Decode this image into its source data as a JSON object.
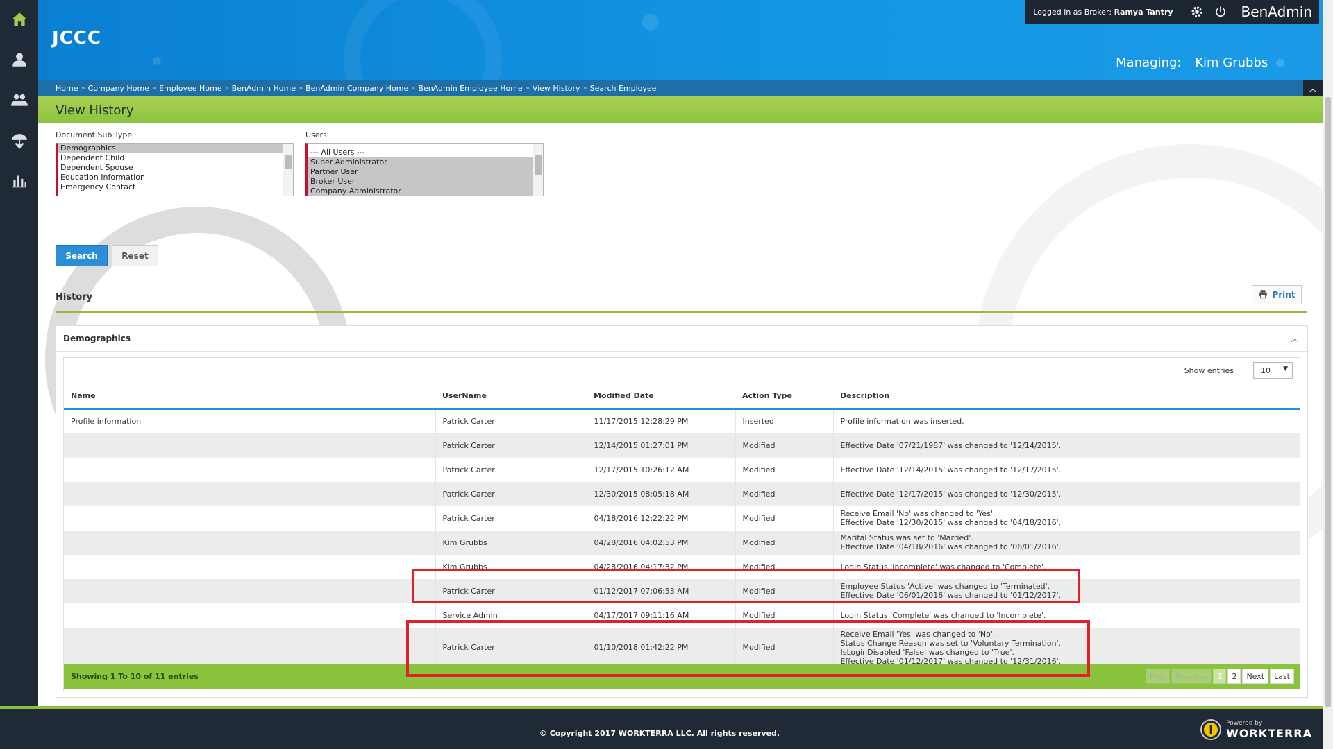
{
  "app": {
    "logo": "JCCC",
    "name": "BenAdmin"
  },
  "header": {
    "logged_in_label": "Logged in as Broker:",
    "user_name": "Ramya Tantry",
    "managing_label": "Managing:",
    "managing_name": "Kim Grubbs"
  },
  "sidebar": {
    "items": [
      {
        "icon": "home-icon"
      },
      {
        "icon": "person-icon"
      },
      {
        "icon": "people-icon"
      },
      {
        "icon": "benefits-icon"
      },
      {
        "icon": "bar-chart-icon"
      }
    ]
  },
  "breadcrumb": [
    "Home",
    "Company Home",
    "Employee Home",
    "BenAdmin Home",
    "BenAdmin Company Home",
    "BenAdmin Employee Home",
    "View History",
    "Search Employee"
  ],
  "page": {
    "title": "View History"
  },
  "filters": {
    "doc_subtype_label": "Document Sub Type",
    "doc_subtype_options": [
      "Demographics",
      "Dependent Child",
      "Dependent Spouse",
      "Education Information",
      "Emergency Contact"
    ],
    "doc_subtype_selected": "Demographics",
    "users_label": "Users",
    "users_options": [
      "--- All Users ---",
      "Super Administrator",
      "Partner User",
      "Broker User",
      "Company Administrator"
    ],
    "users_selected": [
      "Super Administrator",
      "Partner User",
      "Broker User",
      "Company Administrator"
    ]
  },
  "buttons": {
    "search": "Search",
    "reset": "Reset",
    "print": "Print"
  },
  "history": {
    "title": "History",
    "panel_title": "Demographics",
    "show_entries_label": "Show entries",
    "entries_value": "10",
    "columns": [
      "Name",
      "UserName",
      "Modified Date",
      "Action Type",
      "Description"
    ],
    "rows": [
      {
        "name": "Profile information",
        "user": "Patrick Carter",
        "date": "11/17/2015 12:28:29 PM",
        "action": "Inserted",
        "desc": [
          "Profile information was inserted."
        ]
      },
      {
        "name": "",
        "user": "Patrick Carter",
        "date": "12/14/2015 01:27:01 PM",
        "action": "Modified",
        "desc": [
          "Effective Date '07/21/1987' was changed to '12/14/2015'."
        ]
      },
      {
        "name": "",
        "user": "Patrick Carter",
        "date": "12/17/2015 10:26:12 AM",
        "action": "Modified",
        "desc": [
          "Effective Date '12/14/2015' was changed to '12/17/2015'."
        ]
      },
      {
        "name": "",
        "user": "Patrick Carter",
        "date": "12/30/2015 08:05:18 AM",
        "action": "Modified",
        "desc": [
          "Effective Date '12/17/2015' was changed to '12/30/2015'."
        ]
      },
      {
        "name": "",
        "user": "Patrick Carter",
        "date": "04/18/2016 12:22:22 PM",
        "action": "Modified",
        "desc": [
          "Receive Email 'No' was changed to 'Yes'.",
          "Effective Date '12/30/2015' was changed to '04/18/2016'."
        ]
      },
      {
        "name": "",
        "user": "Kim Grubbs",
        "date": "04/28/2016 04:02:53 PM",
        "action": "Modified",
        "desc": [
          "Marital Status was set to 'Married'.",
          "Effective Date '04/18/2016' was changed to '06/01/2016'."
        ]
      },
      {
        "name": "",
        "user": "Kim Grubbs",
        "date": "04/28/2016 04:17:32 PM",
        "action": "Modified",
        "desc": [
          "Login Status 'Incomplete' was changed to 'Complete'."
        ]
      },
      {
        "name": "",
        "user": "Patrick Carter",
        "date": "01/12/2017 07:06:53 AM",
        "action": "Modified",
        "desc": [
          "Employee Status 'Active' was changed to 'Terminated'.",
          "Effective Date '06/01/2016' was changed to '01/12/2017'."
        ]
      },
      {
        "name": "",
        "user": "Service Admin",
        "date": "04/17/2017 09:11:16 AM",
        "action": "Modified",
        "desc": [
          "Login Status 'Complete' was changed to 'Incomplete'."
        ]
      },
      {
        "name": "",
        "user": "Patrick Carter",
        "date": "01/10/2018 01:42:22 PM",
        "action": "Modified",
        "desc": [
          "Receive Email 'Yes' was changed to 'No'.",
          "Status Change Reason was set to 'Voluntary Termination'.",
          "IsLoginDisabled 'False' was changed to 'True'.",
          "Effective Date '01/12/2017' was changed to '12/31/2016'."
        ]
      }
    ],
    "footer_info": "Showing 1 To 10 of 11 entries",
    "pager": {
      "first": "First",
      "previous": "Previous",
      "pages": [
        "1",
        "2"
      ],
      "current": "1",
      "next": "Next",
      "last": "Last"
    }
  },
  "footer": {
    "copyright": "© Copyright 2017 WORKTERRA LLC. All rights reserved.",
    "powered_by": "Powered by",
    "brand": "WORKTERRA"
  },
  "colors": {
    "header_blue": "#1496e4",
    "accent_green": "#8cc33e",
    "sidebar_dark": "#1f2a36",
    "highlight_red": "#e0202a"
  }
}
